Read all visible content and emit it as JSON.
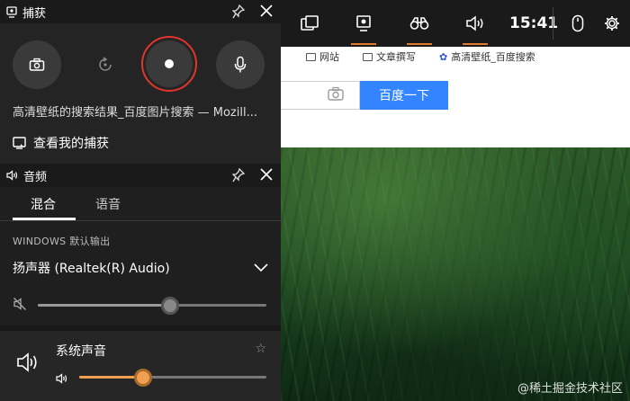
{
  "browser": {
    "bookmarks": [
      "网站",
      "文章撰写",
      "高清壁纸_百度搜索"
    ],
    "search_button": "百度一下"
  },
  "watermark": "@稀土掘金技术社区",
  "topbar": {
    "time": "15:41"
  },
  "capture": {
    "title": "捕获",
    "page_title": "高清壁纸的搜索结果_百度图片搜索 — Mozill...",
    "view_captures": "查看我的捕获"
  },
  "audio": {
    "title": "音频",
    "tabs": [
      "混合",
      "语音"
    ],
    "active_tab": "混合",
    "output_label": "WINDOWS 默认输出",
    "device": "扬声器 (Realtek(R) Audio)",
    "device_volume": 0.58,
    "app_name": "系统声音",
    "app_volume": 0.34
  },
  "colors": {
    "accent": "#e07a2c",
    "record_ring": "#e0352b",
    "slider_active": "#f0a050",
    "search_button": "#3385ff"
  }
}
